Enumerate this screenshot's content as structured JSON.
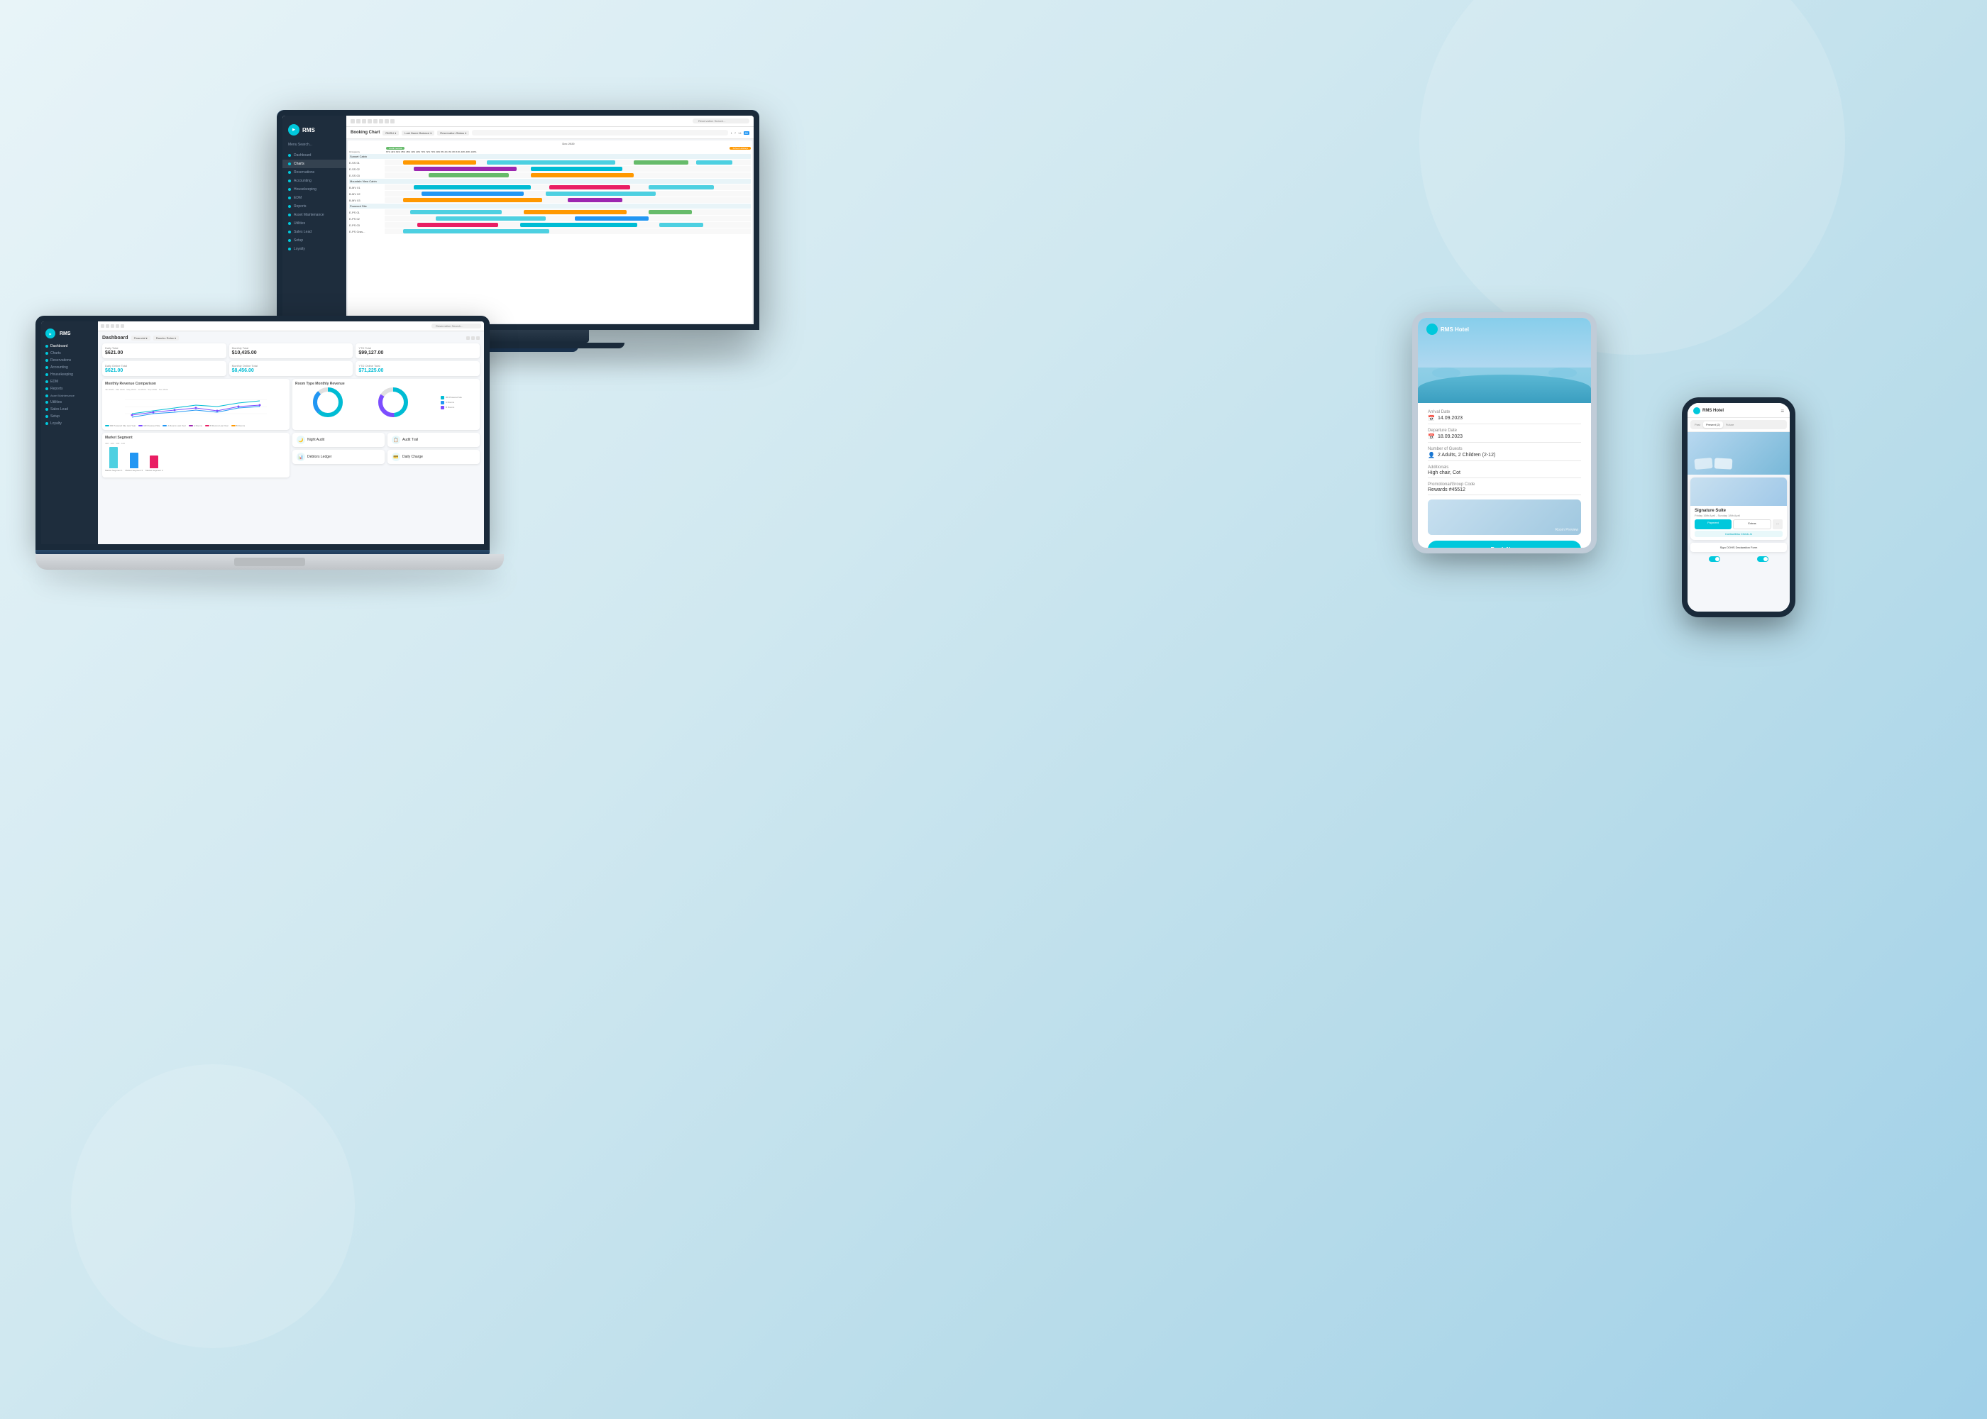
{
  "brand": {
    "name": "RMS",
    "hotel_name": "RMS Hotel",
    "logo_color": "#00c8dc"
  },
  "monitor": {
    "title": "Booking Chart",
    "nav_items": [
      {
        "label": "Dashboard",
        "active": false
      },
      {
        "label": "Charts",
        "active": true
      },
      {
        "label": "Reservations",
        "active": false
      },
      {
        "label": "Accounting",
        "active": false
      },
      {
        "label": "Housekeeping",
        "active": false
      },
      {
        "label": "EDM",
        "active": false
      },
      {
        "label": "Reports",
        "active": false
      },
      {
        "label": "Asset Maintenance",
        "active": false
      },
      {
        "label": "Utilities",
        "active": false
      },
      {
        "label": "Sales Lead",
        "active": false
      },
      {
        "label": "Setup",
        "active": false
      },
      {
        "label": "Loyalty",
        "active": false
      }
    ],
    "dropdowns": [
      "RMSU",
      "Last Name Balance",
      "Reservation Status"
    ],
    "room_rows": [
      {
        "label": "Sunset Cabin",
        "bars": [
          {
            "left": "10%",
            "width": "25%",
            "color": "bar-teal"
          },
          {
            "left": "40%",
            "width": "20%",
            "color": "bar-green"
          }
        ]
      },
      {
        "label": "E-SS 01",
        "bars": [
          {
            "left": "5%",
            "width": "30%",
            "color": "bar-orange"
          },
          {
            "left": "45%",
            "width": "35%",
            "color": "bar-teal"
          }
        ]
      },
      {
        "label": "E-SS 02",
        "bars": [
          {
            "left": "8%",
            "width": "28%",
            "color": "bar-purple"
          },
          {
            "left": "50%",
            "width": "20%",
            "color": "bar-cyan"
          }
        ]
      },
      {
        "label": "E-SS 03",
        "bars": [
          {
            "left": "12%",
            "width": "22%",
            "color": "bar-green"
          },
          {
            "left": "42%",
            "width": "28%",
            "color": "bar-orange"
          }
        ]
      },
      {
        "label": "Mountain View Cabin",
        "bars": [
          {
            "left": "6%",
            "width": "35%",
            "color": "bar-teal"
          },
          {
            "left": "55%",
            "width": "25%",
            "color": "bar-blue"
          }
        ]
      },
      {
        "label": "E-SS 01",
        "bars": [
          {
            "left": "15%",
            "width": "25%",
            "color": "bar-pink"
          },
          {
            "left": "48%",
            "width": "18%",
            "color": "bar-teal"
          }
        ]
      },
      {
        "label": "B-MV 01",
        "bars": [
          {
            "left": "8%",
            "width": "32%",
            "color": "bar-cyan"
          },
          {
            "left": "50%",
            "width": "22%",
            "color": "bar-green"
          }
        ]
      },
      {
        "label": "B-MV 02",
        "bars": [
          {
            "left": "10%",
            "width": "28%",
            "color": "bar-blue"
          },
          {
            "left": "45%",
            "width": "30%",
            "color": "bar-teal"
          }
        ]
      },
      {
        "label": "B-MV 03",
        "bars": [
          {
            "left": "5%",
            "width": "38%",
            "color": "bar-orange"
          },
          {
            "left": "55%",
            "width": "15%",
            "color": "bar-purple"
          }
        ]
      },
      {
        "label": "Powered Site",
        "bars": [
          {
            "left": "12%",
            "width": "20%",
            "color": "bar-green"
          },
          {
            "left": "40%",
            "width": "35%",
            "color": "bar-teal"
          }
        ]
      },
      {
        "label": "E-PS 01",
        "bars": [
          {
            "left": "7%",
            "width": "25%",
            "color": "bar-cyan"
          },
          {
            "left": "40%",
            "width": "28%",
            "color": "bar-orange"
          }
        ]
      },
      {
        "label": "E-PS 02",
        "bars": [
          {
            "left": "14%",
            "width": "30%",
            "color": "bar-teal"
          },
          {
            "left": "52%",
            "width": "20%",
            "color": "bar-blue"
          }
        ]
      },
      {
        "label": "E-PS 03",
        "bars": [
          {
            "left": "9%",
            "width": "22%",
            "color": "bar-pink"
          },
          {
            "left": "44%",
            "width": "32%",
            "color": "bar-cyan"
          }
        ]
      }
    ]
  },
  "laptop": {
    "title": "Dashboard",
    "nav_items": [
      {
        "label": "Dashboard"
      },
      {
        "label": "Charts"
      },
      {
        "label": "Reservations"
      },
      {
        "label": "Accounting"
      },
      {
        "label": "Housekeeping"
      },
      {
        "label": "EDM"
      },
      {
        "label": "Reports"
      },
      {
        "label": "Asset Maintenance"
      },
      {
        "label": "Utilities"
      },
      {
        "label": "Sales Lead"
      },
      {
        "label": "Setup"
      },
      {
        "label": "Loyalty"
      }
    ],
    "stats": {
      "daily_total_label": "Daily Total",
      "daily_total_value": "$621.00",
      "monthly_total_label": "Monthly Total",
      "monthly_total_value": "$10,435.00",
      "ytd_total_label": "YTD Total",
      "ytd_total_value": "$99,127.00",
      "daily_online_label": "Daily Online Total",
      "daily_online_value": "$621.00",
      "monthly_online_label": "Monthly Online Total",
      "monthly_online_value": "$8,456.00",
      "ytd_online_label": "YTD Online Total",
      "ytd_online_value": "$71,225.00"
    },
    "charts": {
      "revenue_comparison_title": "Monthly Revenue Comparison",
      "room_type_title": "Room Type Monthly Revenue",
      "market_segment_title": "Market Segment"
    },
    "quick_actions": [
      {
        "label": "Night Audit",
        "icon": "🌙"
      },
      {
        "label": "Audit Trail",
        "icon": "📋"
      },
      {
        "label": "Debtors Ledger",
        "icon": "📊"
      },
      {
        "label": "Daily Charge",
        "icon": "💳"
      }
    ],
    "market_bars": [
      {
        "label": "Market Segment 1",
        "height": 30,
        "color": "#4dd0e1"
      },
      {
        "label": "Market Segment 3",
        "height": 22,
        "color": "#2196f3"
      },
      {
        "label": "Market Segment 2",
        "height": 18,
        "color": "#e91e63"
      }
    ]
  },
  "tablet": {
    "arrival_date_label": "Arrival Date",
    "arrival_date_value": "14.09.2023",
    "departure_date_label": "Departure Date",
    "departure_date_value": "18.09.2023",
    "guests_label": "Number of Guests",
    "guests_value": "2 Adults, 2 Children (2-12)",
    "additionals_label": "Additionals",
    "additionals_value": "High chair, Cot",
    "promo_label": "Promotional/Group Code",
    "promo_value": "Rewards #45512",
    "book_btn": "Book Now"
  },
  "phone": {
    "tabs": [
      "Past",
      "Present (2)",
      "Future"
    ],
    "room_name": "Signature Suite",
    "room_dates": "Friday 16th April - Sunday 18th April",
    "btn_payment": "Payment",
    "btn_extras": "Extras",
    "btn_check_in": "Contactless Check-In",
    "btn_sign": "Sign OOHS Declaration Form"
  }
}
